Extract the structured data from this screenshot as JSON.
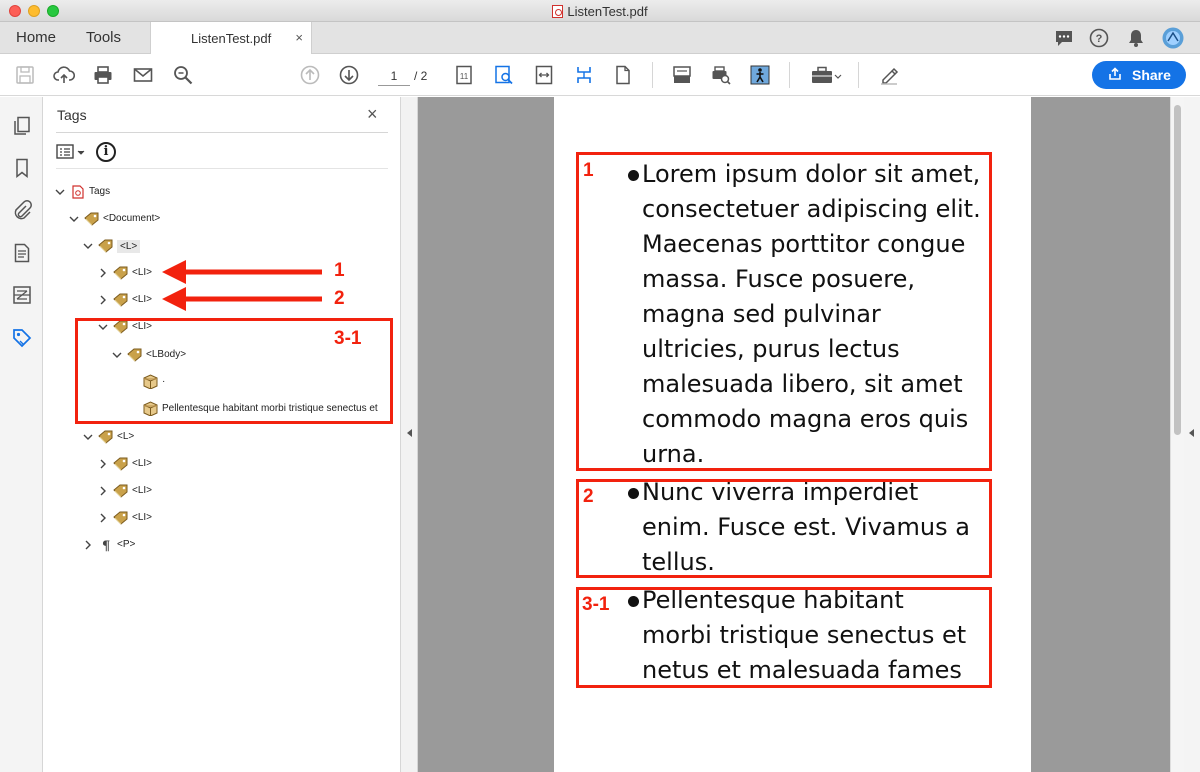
{
  "window": {
    "title": "ListenTest.pdf"
  },
  "tabs": {
    "home": "Home",
    "tools": "Tools",
    "document": "ListenTest.pdf",
    "close": "×"
  },
  "toolbar": {
    "page_current": "1",
    "page_total": "/ 2",
    "share_label": "Share"
  },
  "tags_panel": {
    "title": "Tags",
    "close": "×",
    "info_glyph": "i",
    "tree": {
      "root": "Tags",
      "document": "<Document>",
      "l1": "<L>",
      "li1": "<LI>",
      "li2": "<LI>",
      "li3": "<LI>",
      "lbody": "<LBody>",
      "content1": "·",
      "content2": "Pellentesque habitant morbi tristique senectus et",
      "l2": "<L>",
      "l2_li1": "<LI>",
      "l2_li2": "<LI>",
      "l2_li3": "<LI>",
      "p": "<P>"
    }
  },
  "annotations": {
    "arrow1": "1",
    "arrow2": "2",
    "box_panel": "3-1",
    "box1": "1",
    "box2": "2",
    "box3": "3-1",
    "color": "#f2220e"
  },
  "document": {
    "item1": [
      "Lorem ipsum dolor sit amet,",
      "consectetuer adipiscing elit.",
      "Maecenas porttitor congue",
      "massa. Fusce posuere,",
      "magna sed pulvinar",
      "ultricies, purus lectus",
      "malesuada libero, sit amet",
      "commodo magna eros quis",
      "urna."
    ],
    "item2": [
      "Nunc viverra imperdiet",
      "enim. Fusce est. Vivamus a",
      "tellus."
    ],
    "item3": [
      "Pellentesque habitant",
      "morbi tristique senectus et",
      "netus et malesuada fames"
    ]
  },
  "icons": {
    "titlebar": "pdf-file-icon",
    "toolbar": [
      "save-icon",
      "upload-icon",
      "print-icon",
      "email-icon",
      "zoom-icon",
      "page-up-icon",
      "page-down-icon",
      "single-page-icon",
      "find-text-icon",
      "fit-width-icon",
      "fit-height-icon",
      "blank-page-icon",
      "scan-icon",
      "print-preview-icon",
      "accessibility-icon",
      "toolbox-icon",
      "highlight-pen-icon"
    ],
    "header": [
      "comment-icon",
      "help-icon",
      "bell-icon",
      "avatar"
    ],
    "rail": [
      "pages-icon",
      "bookmark-icon",
      "attachment-icon",
      "page-content-icon",
      "order-icon",
      "tag-icon"
    ]
  }
}
